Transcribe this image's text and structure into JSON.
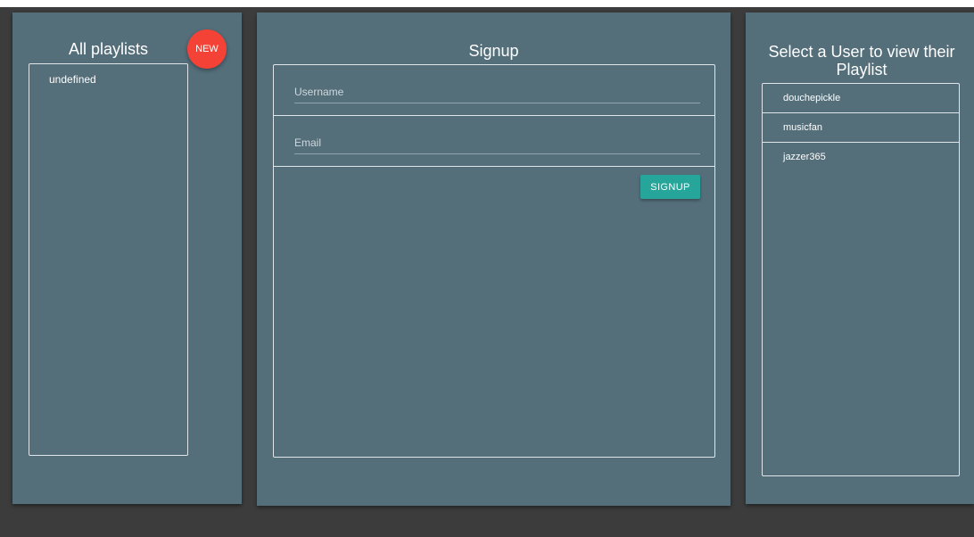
{
  "left_panel": {
    "title": "All playlists",
    "new_badge": "NEW",
    "playlists": [
      "undefined"
    ]
  },
  "signup_panel": {
    "title": "Signup",
    "username_placeholder": "Username",
    "email_placeholder": "Email",
    "button_label": "SIGNUP"
  },
  "users_panel": {
    "title": "Select a User to view their Playlist",
    "users": [
      "douchepickle",
      "musicfan",
      "jazzer365"
    ]
  },
  "colors": {
    "background": "#3c3c3c",
    "panel": "#546e7a",
    "new_badge": "#f44336",
    "signup_button": "#26a69a"
  }
}
